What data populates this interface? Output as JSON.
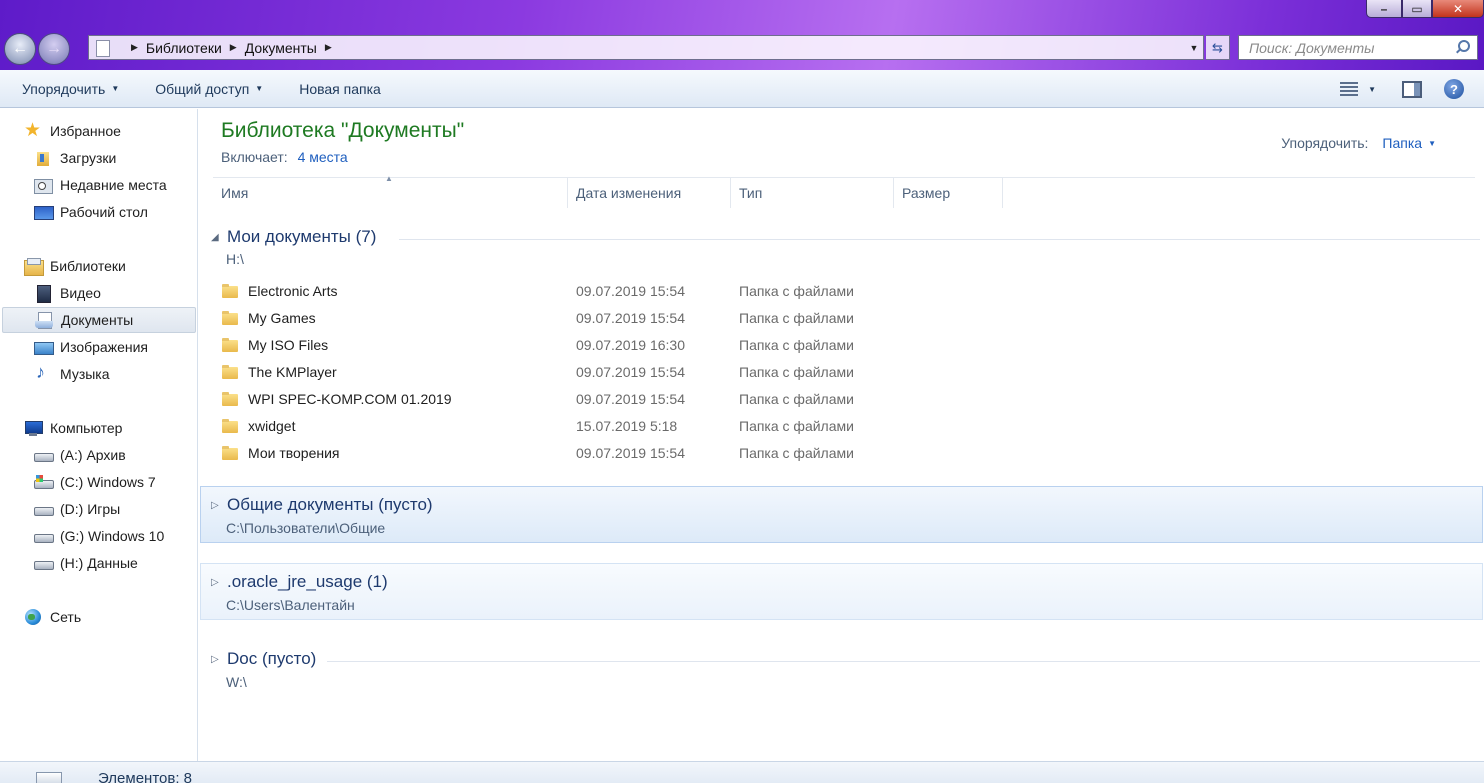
{
  "window": {
    "minimize_icon": "minimize-icon",
    "maximize_icon": "maximize-icon",
    "close_icon": "close-icon"
  },
  "address": {
    "crumbs": [
      "Библиотеки",
      "Документы"
    ],
    "search_placeholder": "Поиск: Документы"
  },
  "toolbar": {
    "organize": "Упорядочить",
    "share": "Общий доступ",
    "new_folder": "Новая папка"
  },
  "nav": {
    "favorites": "Избранное",
    "downloads": "Загрузки",
    "recent": "Недавние места",
    "desktop": "Рабочий стол",
    "libraries": "Библиотеки",
    "video": "Видео",
    "documents": "Документы",
    "images": "Изображения",
    "music": "Музыка",
    "computer": "Компьютер",
    "drives": [
      "(A:) Архив",
      "(C:) Windows 7",
      "(D:) Игры",
      "(G:) Windows 10",
      "(H:) Данные"
    ],
    "network": "Сеть"
  },
  "library": {
    "title": "Библиотека \"Документы\"",
    "includes_label": "Включает:",
    "includes_link": "4 места",
    "arrange_label": "Упорядочить:",
    "arrange_value": "Папка"
  },
  "columns": {
    "name": "Имя",
    "date": "Дата изменения",
    "type": "Тип",
    "size": "Размер"
  },
  "groups": [
    {
      "title": "Мои документы (7)",
      "path": "H:\\",
      "expanded": true,
      "items": [
        {
          "name": "Electronic Arts",
          "date": "09.07.2019 15:54",
          "type": "Папка с файлами"
        },
        {
          "name": "My Games",
          "date": "09.07.2019 15:54",
          "type": "Папка с файлами"
        },
        {
          "name": "My ISO Files",
          "date": "09.07.2019 16:30",
          "type": "Папка с файлами"
        },
        {
          "name": "The KMPlayer",
          "date": "09.07.2019 15:54",
          "type": "Папка с файлами"
        },
        {
          "name": "WPI SPEC-KOMP.COM 01.2019",
          "date": "09.07.2019 15:54",
          "type": "Папка с файлами"
        },
        {
          "name": "xwidget",
          "date": "15.07.2019 5:18",
          "type": "Папка с файлами"
        },
        {
          "name": "Мои творения",
          "date": "09.07.2019 15:54",
          "type": "Папка с файлами"
        }
      ]
    },
    {
      "title": "Общие документы (пусто)",
      "path": "C:\\Пользователи\\Общие",
      "expanded": false
    },
    {
      "title": ".oracle_jre_usage (1)",
      "path": "C:\\Users\\Валентайн",
      "expanded": false
    },
    {
      "title": "Doc (пусто)",
      "path": "W:\\",
      "expanded": false
    }
  ],
  "status": {
    "text": "Элементов: 8"
  }
}
